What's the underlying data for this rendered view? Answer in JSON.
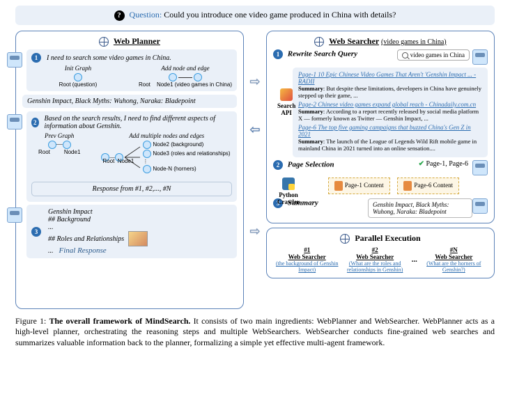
{
  "question": {
    "icon": "?",
    "label": "Question:",
    "text": "Could you introduce one video game produced in China with details?"
  },
  "planner": {
    "title": "Web Planner",
    "step1": {
      "num": "1",
      "text": "I need to search some video games in China.",
      "init_label": "Init Graph",
      "add_label": "Add node and edge",
      "root": "Root (question)",
      "root2": "Root",
      "node1": "Node1 (video games in China)"
    },
    "result1": "Genshin Impact, Black Myths: Wuhong, Naraka: Bladepoint",
    "step2": {
      "num": "2",
      "text": "Based on the search results, I need to find different aspects of information about Genshin.",
      "prev_label": "Prev Graph",
      "add_label": "Add multiple nodes and edges",
      "root": "Root",
      "node1": "Node1",
      "node2": "Node2 (background)",
      "node3": "Node3 (roles and relationships)",
      "nodeN": "Node-N (horners)"
    },
    "response_box": "Response from #1, #2,..., #N",
    "step3": {
      "num": "3",
      "line1": "Genshin Impact",
      "line2": "## Background",
      "line3": "...",
      "line4": "## Roles and Relationships",
      "line5": "...",
      "final": "Final Response"
    }
  },
  "searcher": {
    "title": "Web Searcher",
    "subtitle": "(video games in China)",
    "s1": {
      "num": "1",
      "label": "Rewrite Search Query"
    },
    "search_value": "video games in China",
    "api_label": "Search\nAPI",
    "pages": [
      {
        "title": "Page-1 10 Epic Chinese Video Games That Aren't 'Genshin Impact ... - RADII",
        "summary_label": "Summary",
        "summary": ": But despite these limitations, developers in China have genuinely stepped up their game, ..."
      },
      {
        "title": "Page-2 Chinese video games expand global reach - Chinadaily.com.cn",
        "summary_label": "Summary",
        "summary": ": According to a report recently released by social media platform X — formerly known as Twitter — Genshin Impact, ..."
      },
      {
        "title": "Page-6 The top five gaming campaigns that buzzed China's Gen Z in 2021",
        "summary_label": "Summary",
        "summary": ": The launch of the League of Legends Wild Rift mobile game in mainland China in 2021 turned into an online sensation...."
      }
    ],
    "s2": {
      "num": "2",
      "label": "Page Selection",
      "selected": "Page-1, Page-6"
    },
    "crawler_label": "Python\nCrawler",
    "content1": "Page-1 Content",
    "content2": "Page-6 Content",
    "s3": {
      "num": "3",
      "label": "Summary"
    },
    "summary_out": "Genshin Impact, Black Myths: Wuhong, Naraka: Bladepoint"
  },
  "parallel": {
    "title": "Parallel Execution",
    "items": [
      {
        "num": "#1",
        "name": "Web Searcher",
        "query": "(the background of Genshin Impact)"
      },
      {
        "num": "#2",
        "name": "Web Searcher",
        "query": "(What are the roles and relationships in Genshin)"
      },
      {
        "dots": "..."
      },
      {
        "num": "#N",
        "name": "Web Searcher",
        "query": "(What are the horners of Genshin?)"
      }
    ]
  },
  "caption": {
    "fig": "Figure 1: ",
    "bold": "The overall framework of MindSearch.",
    "rest": " It consists of two main ingredients: WebPlanner and WebSearcher. WebPlanner acts as a high-level planner, orchestrating the reasoning steps and multiple WebSearchers. WebSearcher conducts fine-grained web searches and summarizes valuable information back to the planner, formalizing a simple yet effective multi-agent framework."
  }
}
